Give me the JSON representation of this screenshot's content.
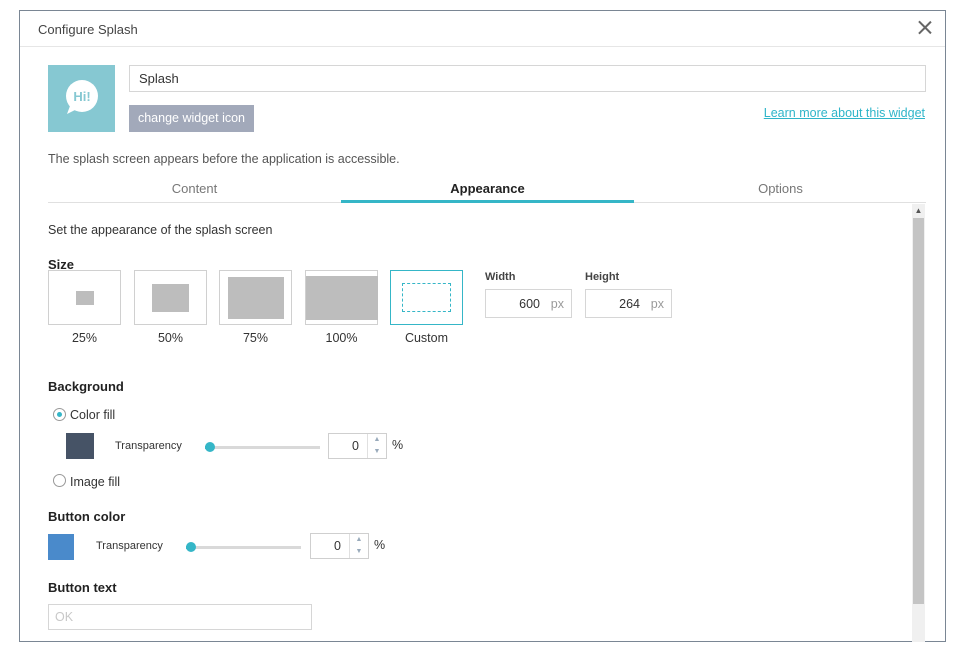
{
  "dialog": {
    "title": "Configure Splash"
  },
  "widget": {
    "icon_text": "Hi!",
    "name_value": "Splash",
    "change_icon_label": "change widget icon",
    "learn_more_label": "Learn more about this widget",
    "description": "The splash screen appears before the application is accessible.",
    "icon_color": "#86c8d2"
  },
  "tabs": [
    {
      "label": "Content",
      "active": false
    },
    {
      "label": "Appearance",
      "active": true
    },
    {
      "label": "Options",
      "active": false
    }
  ],
  "appearance": {
    "intro": "Set the appearance of the splash screen",
    "size": {
      "heading": "Size",
      "options": [
        "25%",
        "50%",
        "75%",
        "100%",
        "Custom"
      ],
      "selected": "Custom",
      "width_label": "Width",
      "width_value": "600",
      "height_label": "Height",
      "height_value": "264",
      "unit": "px"
    },
    "background": {
      "heading": "Background",
      "color_fill_label": "Color fill",
      "image_fill_label": "Image fill",
      "selected": "Color fill",
      "color": "#465366",
      "transparency_label": "Transparency",
      "transparency_value": "0",
      "percent": "%"
    },
    "button_color": {
      "heading": "Button color",
      "color": "#4a8acb",
      "transparency_label": "Transparency",
      "transparency_value": "0",
      "percent": "%"
    },
    "button_text": {
      "heading": "Button text",
      "placeholder": "OK"
    }
  },
  "accent_color": "#35b6c7"
}
